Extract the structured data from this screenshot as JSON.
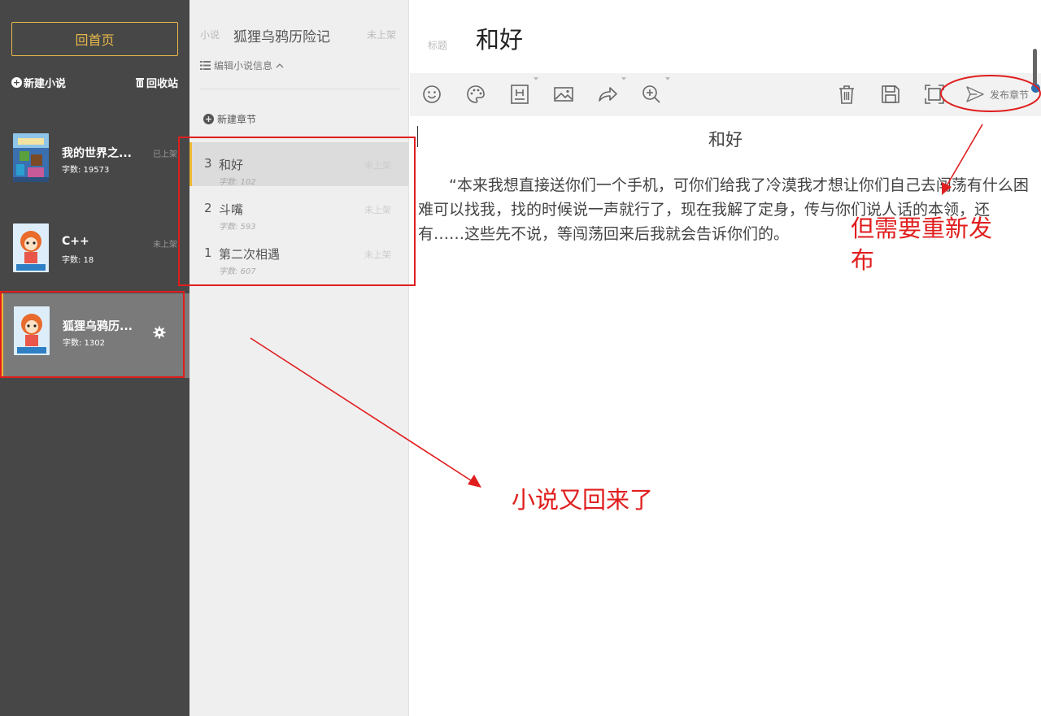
{
  "sidebar": {
    "home_label": "回首页",
    "new_novel_label": "新建小说",
    "recycle_label": "回收站",
    "novels": [
      {
        "title": "我的世界之...",
        "word_count": "字数: 19573",
        "status": "已上架"
      },
      {
        "title": "C++",
        "word_count": "字数: 18",
        "status": "未上架"
      },
      {
        "title": "狐狸乌鸦历...",
        "word_count": "字数: 1302"
      }
    ]
  },
  "middle": {
    "novel_label": "小说",
    "novel_title": "狐狸乌鸦历险记",
    "novel_status": "未上架",
    "edit_info_label": "编辑小说信息",
    "new_chapter_label": "新建章节",
    "chapters": [
      {
        "num": "3",
        "name": "和好",
        "word_count": "字数: 102",
        "status": "未上架",
        "active": true
      },
      {
        "num": "2",
        "name": "斗嘴",
        "word_count": "字数: 593",
        "status": "未上架"
      },
      {
        "num": "1",
        "name": "第二次相遇",
        "word_count": "字数: 607",
        "status": "未上架"
      }
    ]
  },
  "editor": {
    "title_label": "标题",
    "title": "和好",
    "publish_label": "发布章节",
    "doc_heading": "和好",
    "doc_paragraph": "“本来我想直接送你们一个手机，可你们给我了冷漠我才想让你们自己去闯荡有什么困难可以找我，找的时候说一声就行了，现在我解了定身，传与你们说人话的本领，还有……这些先不说，等闯荡回来后我就会告诉你们的。"
  },
  "annotations": {
    "note_republish": "但需要重新发布",
    "note_returned": "小说又回来了",
    "color": "#e01e1e"
  },
  "icons": [
    "plus-circle-icon",
    "trash-icon",
    "gear-icon",
    "list-icon",
    "chevron-up-icon",
    "emoji-icon",
    "palette-icon",
    "heading-icon",
    "image-icon",
    "share-icon",
    "zoom-in-icon",
    "delete-icon",
    "save-icon",
    "fullscreen-icon",
    "send-icon"
  ]
}
